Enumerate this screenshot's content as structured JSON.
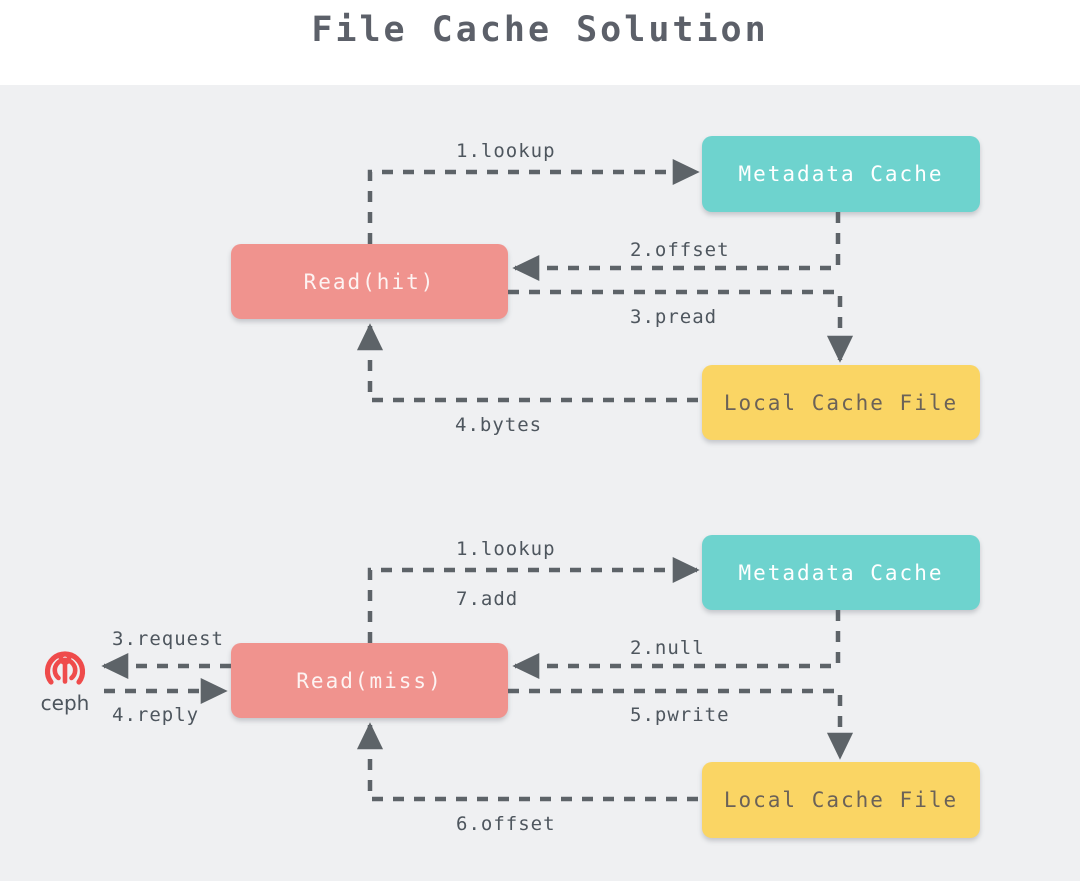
{
  "header": {
    "title": "File Cache Solution"
  },
  "colors": {
    "background": "#ffffff",
    "canvas": "#eff0f2",
    "read_box": "#f0938e",
    "metadata_box": "#6ed3ce",
    "file_box": "#fad564",
    "wire": "#5d6368",
    "label_text": "#4e565e",
    "title_text": "#5c6069",
    "ceph_mark": "#ef4b4b"
  },
  "diagrams": [
    {
      "id": "read-hit",
      "nodes": [
        {
          "id": "read-hit",
          "label": "Read(hit)",
          "kind": "read"
        },
        {
          "id": "metadata-cache-hit",
          "label": "Metadata Cache",
          "kind": "metadata"
        },
        {
          "id": "local-cache-file-hit",
          "label": "Local Cache File",
          "kind": "file"
        }
      ],
      "edges": [
        {
          "id": "hit-1",
          "label": "1.lookup",
          "from": "read-hit",
          "to": "metadata-cache-hit"
        },
        {
          "id": "hit-2",
          "label": "2.offset",
          "from": "metadata-cache-hit",
          "to": "read-hit"
        },
        {
          "id": "hit-3",
          "label": "3.pread",
          "from": "read-hit",
          "to": "local-cache-file-hit"
        },
        {
          "id": "hit-4",
          "label": "4.bytes",
          "from": "local-cache-file-hit",
          "to": "read-hit"
        }
      ]
    },
    {
      "id": "read-miss",
      "nodes": [
        {
          "id": "ceph",
          "label": "ceph",
          "kind": "external"
        },
        {
          "id": "read-miss",
          "label": "Read(miss)",
          "kind": "read"
        },
        {
          "id": "metadata-cache-miss",
          "label": "Metadata Cache",
          "kind": "metadata"
        },
        {
          "id": "local-cache-file-miss",
          "label": "Local Cache File",
          "kind": "file"
        }
      ],
      "edges": [
        {
          "id": "miss-1",
          "label": "1.lookup",
          "from": "read-miss",
          "to": "metadata-cache-miss"
        },
        {
          "id": "miss-7",
          "label": "7.add",
          "from": "read-miss",
          "to": "metadata-cache-miss"
        },
        {
          "id": "miss-2",
          "label": "2.null",
          "from": "metadata-cache-miss",
          "to": "read-miss"
        },
        {
          "id": "miss-3",
          "label": "3.request",
          "from": "read-miss",
          "to": "ceph"
        },
        {
          "id": "miss-4",
          "label": "4.reply",
          "from": "ceph",
          "to": "read-miss"
        },
        {
          "id": "miss-5",
          "label": "5.pwrite",
          "from": "read-miss",
          "to": "local-cache-file-miss"
        },
        {
          "id": "miss-6",
          "label": "6.offset",
          "from": "local-cache-file-miss",
          "to": "read-miss"
        }
      ]
    }
  ]
}
